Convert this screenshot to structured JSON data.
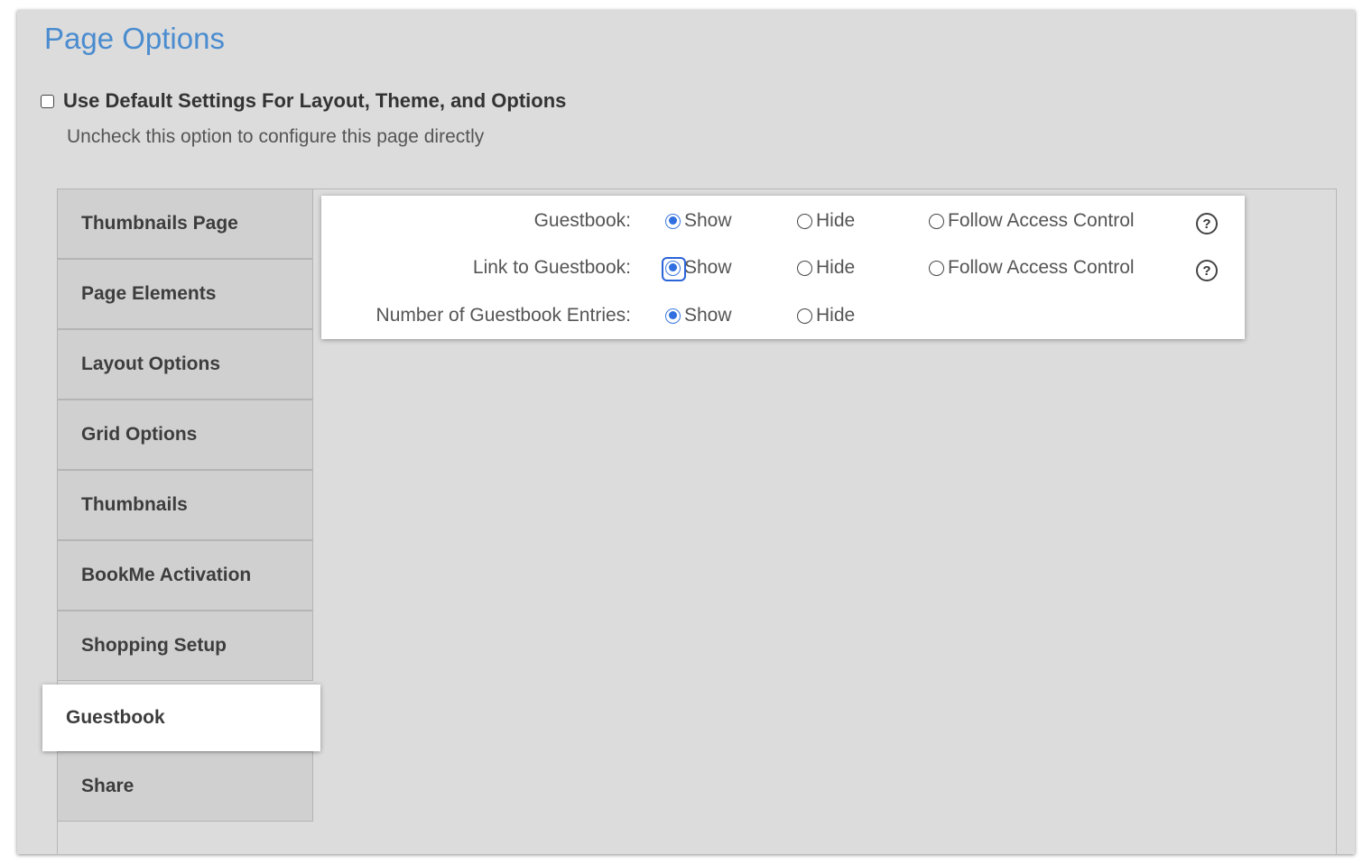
{
  "page": {
    "title": "Page Options",
    "default_settings": {
      "label": "Use Default Settings For Layout, Theme, and Options",
      "hint": "Uncheck this option to configure this page directly",
      "checked": false
    }
  },
  "tabs": [
    {
      "label": "Thumbnails Page",
      "active": false
    },
    {
      "label": "Page Elements",
      "active": false
    },
    {
      "label": "Layout Options",
      "active": false
    },
    {
      "label": "Grid Options",
      "active": false
    },
    {
      "label": "Thumbnails",
      "active": false
    },
    {
      "label": "BookMe Activation",
      "active": false
    },
    {
      "label": "Shopping Setup",
      "active": false
    },
    {
      "label": "Guestbook",
      "active": true
    },
    {
      "label": "Share",
      "active": false
    }
  ],
  "guestbook_settings": {
    "rows": [
      {
        "label": "Guestbook:",
        "selected": "Show",
        "options": [
          "Show",
          "Hide",
          "Follow Access Control"
        ],
        "help_icon": "question-circle-icon"
      },
      {
        "label": "Link to Guestbook:",
        "selected": "Show",
        "options": [
          "Show",
          "Hide",
          "Follow Access Control"
        ],
        "help_icon": "question-circle-icon",
        "focused": true
      },
      {
        "label": "Number of Guestbook Entries:",
        "selected": "Show",
        "options": [
          "Show",
          "Hide"
        ]
      }
    ],
    "help_glyph": "?"
  },
  "colors": {
    "title": "#4a8ccf",
    "panel_background": "#dcdcdc",
    "radio_selected": "#2f6fe0"
  }
}
